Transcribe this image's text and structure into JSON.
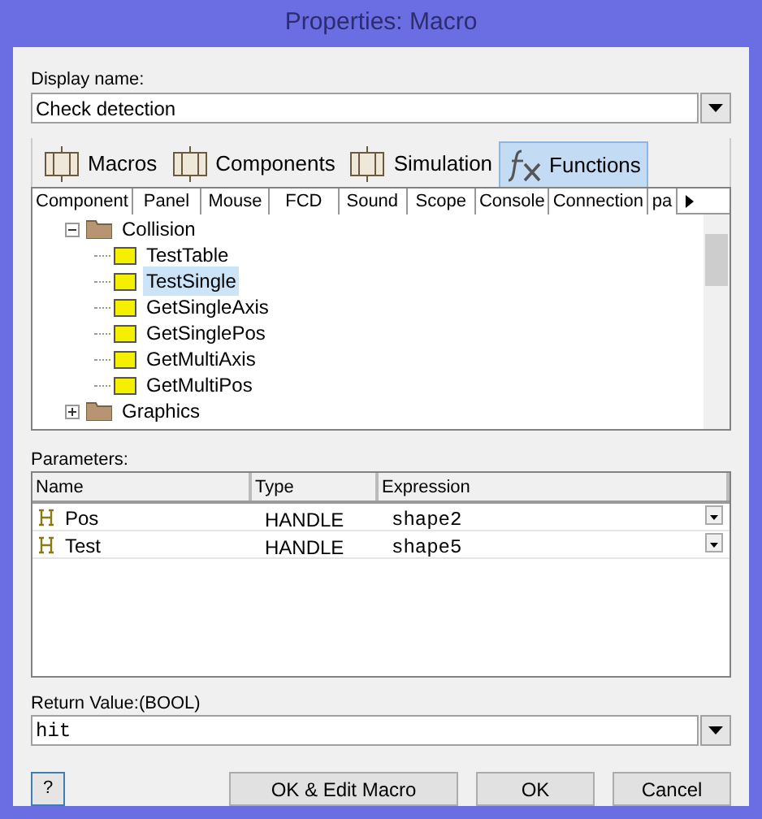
{
  "window": {
    "title": "Properties: Macro"
  },
  "display_name": {
    "label": "Display name:",
    "value": "Check detection"
  },
  "tabs": [
    {
      "label": "Macros",
      "selected": false
    },
    {
      "label": "Components",
      "selected": false
    },
    {
      "label": "Simulation",
      "selected": false
    },
    {
      "label": "Functions",
      "selected": true
    }
  ],
  "subtabs": [
    "Component",
    "Panel",
    "Mouse",
    "FCD",
    "Sound",
    "Scope",
    "Console",
    "Connection",
    "pa"
  ],
  "tree": [
    {
      "label": "Collision",
      "kind": "folder",
      "expanded": true,
      "selected": false,
      "children": [
        {
          "label": "TestTable",
          "kind": "function",
          "selected": false
        },
        {
          "label": "TestSingle",
          "kind": "function",
          "selected": true
        },
        {
          "label": "GetSingleAxis",
          "kind": "function",
          "selected": false
        },
        {
          "label": "GetSinglePos",
          "kind": "function",
          "selected": false
        },
        {
          "label": "GetMultiAxis",
          "kind": "function",
          "selected": false
        },
        {
          "label": "GetMultiPos",
          "kind": "function",
          "selected": false
        }
      ]
    },
    {
      "label": "Graphics",
      "kind": "folder",
      "expanded": false,
      "selected": false
    }
  ],
  "parameters": {
    "label": "Parameters:",
    "columns": [
      "Name",
      "Type",
      "Expression"
    ],
    "rows": [
      {
        "name": "Pos",
        "type": "HANDLE",
        "expression": "shape2"
      },
      {
        "name": "Test",
        "type": "HANDLE",
        "expression": "shape5"
      }
    ]
  },
  "return_value": {
    "label": "Return Value:(BOOL)",
    "value": "hit"
  },
  "buttons": {
    "help": "?",
    "ok_edit": "OK & Edit Macro",
    "ok": "OK",
    "cancel": "Cancel"
  }
}
